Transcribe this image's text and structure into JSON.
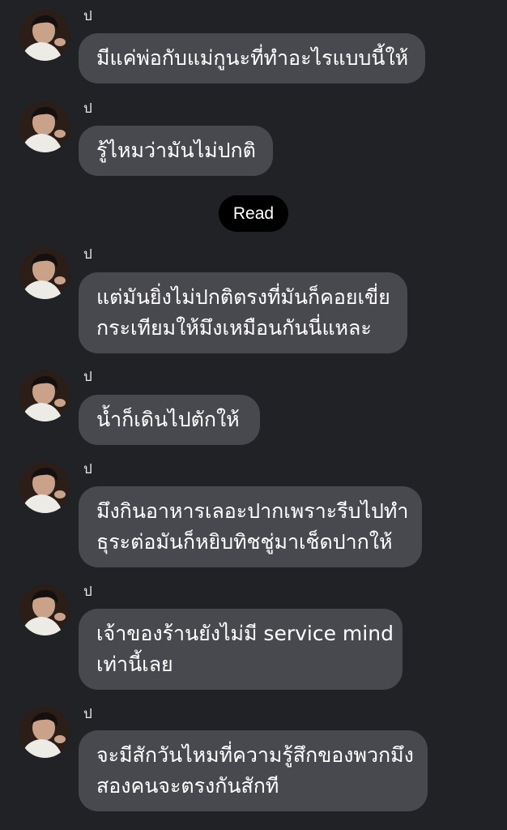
{
  "read_receipt": "Read",
  "messages": [
    {
      "sender": "ป",
      "lines": [
        "มีแค่พ่อกับแม่กูนะที่ทำอะไรแบบนี้ให้"
      ]
    },
    {
      "sender": "ป",
      "lines": [
        "รู้ไหมว่ามันไม่ปกติ"
      ]
    },
    {
      "sender": "ป",
      "lines": [
        "แต่มันยิ่งไม่ปกติตรงที่มันก็คอยเขี่ย",
        "กระเทียมให้มึงเหมือนกันนี่แหละ"
      ]
    },
    {
      "sender": "ป",
      "lines": [
        "น้ำก็เดินไปตักให้"
      ]
    },
    {
      "sender": "ป",
      "lines": [
        "มึงกินอาหารเลอะปากเพราะรีบไปทำ",
        "ธุระต่อมันก็หยิบทิชชู่มาเช็ดปากให้"
      ]
    },
    {
      "sender": "ป",
      "lines": [
        "เจ้าของร้านยังไม่มี service mind",
        "เท่านี้เลย"
      ]
    },
    {
      "sender": "ป",
      "lines": [
        "จะมีสักวันไหมที่ความรู้สึกของพวกมึง",
        "สองคนจะตรงกันสักที"
      ]
    }
  ],
  "colors": {
    "background": "#212226",
    "bubble": "#48494e",
    "read_pill": "#000000",
    "text": "#ffffff"
  },
  "icons": {
    "avatar": "profile-photo"
  }
}
